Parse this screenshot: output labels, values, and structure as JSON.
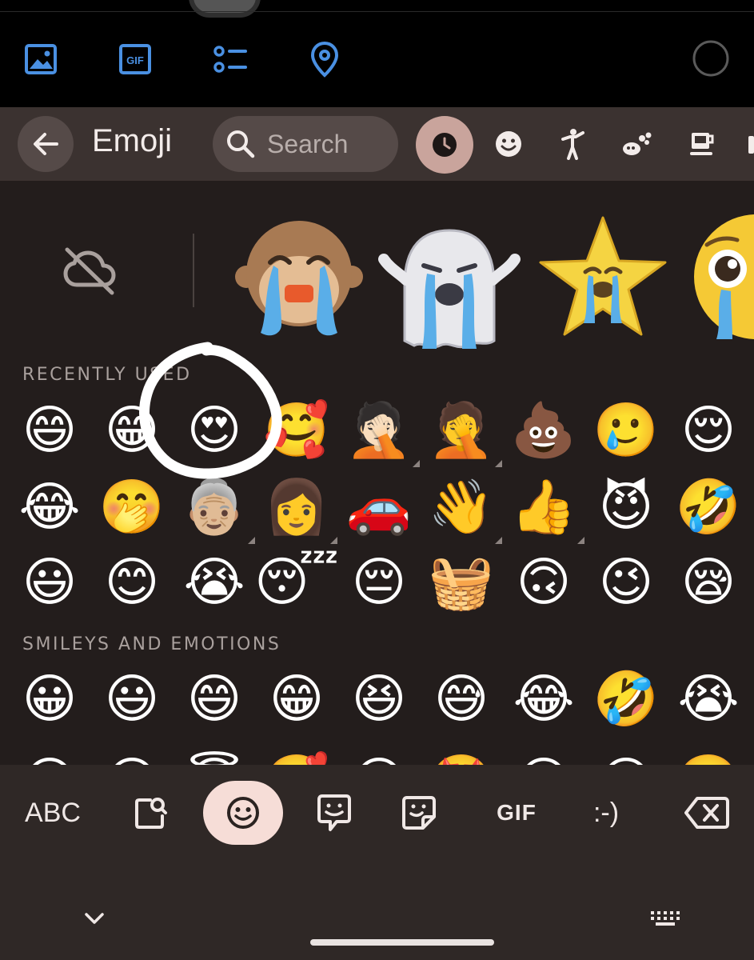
{
  "attachment_bar": {
    "icons": [
      "image-icon",
      "gif-icon",
      "checklist-icon",
      "location-pin-icon",
      "circle-icon"
    ],
    "accent_color": "#4a90e2"
  },
  "header": {
    "title": "Emoji",
    "search_placeholder": "Search",
    "category_tabs": [
      "recent-clock-icon",
      "smiley-icon",
      "person-icon",
      "animals-nature-icon",
      "food-drink-icon"
    ]
  },
  "sticker_row": {
    "items": [
      "crying-monkey",
      "crying-ghost",
      "crying-star",
      "crying-face"
    ]
  },
  "recently_used": {
    "label": "RECENTLY USED",
    "rows": [
      [
        "😄",
        "😁",
        "😍",
        "🥰",
        "🤦🏻",
        "🤦",
        "💩",
        "🥲",
        "😌"
      ],
      [
        "😂",
        "🤭",
        "👵🏼",
        "👩",
        "🚗",
        "👋",
        "👍",
        "😈",
        "🤣"
      ],
      [
        "😃",
        "😊",
        "😭",
        "😴",
        "😔",
        "🧺",
        "🙃",
        "😉",
        "😪"
      ]
    ]
  },
  "smileys_and_emotions": {
    "label": "SMILEYS AND EMOTIONS",
    "rows": [
      [
        "😀",
        "😃",
        "😄",
        "😁",
        "😆",
        "😅",
        "😂",
        "🤣",
        "😭"
      ],
      [
        "😉",
        "😊",
        "😇",
        "🥰",
        "😍",
        "🤩",
        "😘",
        "😗",
        "☺️"
      ]
    ]
  },
  "footer": {
    "abc_label": "ABC",
    "gif_label": "GIF",
    "emoticon_label": ":-)",
    "modes": [
      "abc-button",
      "emoji-kitchen-button",
      "emoji-button",
      "bitmoji-button",
      "sticker-button",
      "gif-button",
      "emoticon-button",
      "backspace-button"
    ],
    "active_mode": "emoji-button",
    "active_color": "#f6ddd7"
  },
  "colors": {
    "header_bg": "#3b3230",
    "body_bg": "#231d1c",
    "footer_bg": "#2f2826",
    "selected_tab_bg": "#c9a49c"
  }
}
